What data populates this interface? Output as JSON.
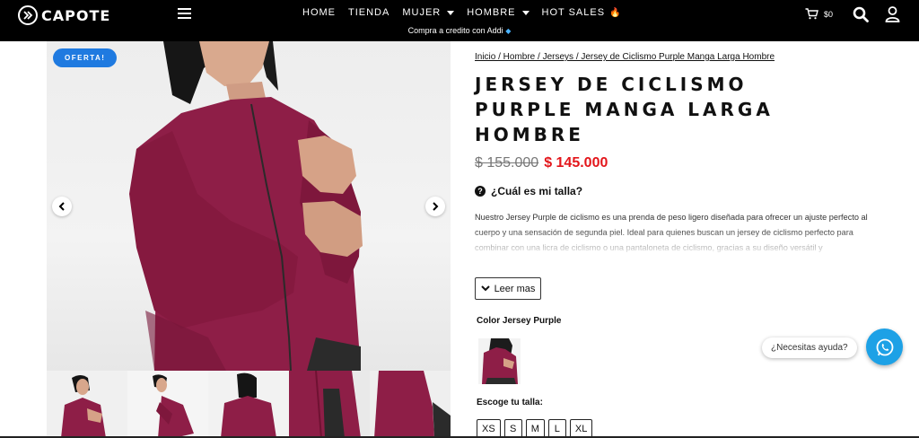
{
  "header": {
    "logo_text": "CAPOTE",
    "nav": [
      {
        "label": "HOME",
        "dropdown": false
      },
      {
        "label": "TIENDA",
        "dropdown": false
      },
      {
        "label": "MUJER",
        "dropdown": true
      },
      {
        "label": "HOMBRE",
        "dropdown": true
      },
      {
        "label": "HOT SALES",
        "dropdown": false,
        "emoji": "🔥"
      }
    ],
    "promo": "Compra a credito con Addi",
    "cart_total": "$0",
    "colors": {
      "bar": "#000000",
      "text": "#ffffff"
    }
  },
  "gallery": {
    "badge": "OFERTA!",
    "badge_color": "#1f7ae0",
    "prev_icon": "chevron-left-icon",
    "next_icon": "chevron-right-icon",
    "thumbnail_count": 5
  },
  "product": {
    "breadcrumb": "Inicio / Hombre / Jerseys / Jersey de Ciclismo Purple Manga Larga Hombre",
    "title": "JERSEY DE CICLISMO PURPLE MANGA LARGA HOMBRE",
    "price_old": "$ 155.000",
    "price_new": "$ 145.000",
    "price_color": "#e3161b",
    "size_help": "¿Cuál es mi talla?",
    "description": "Nuestro Jersey Purple de ciclismo es una prenda de peso ligero diseñada para ofrecer un ajuste perfecto al cuerpo y una sensación de segunda piel. Ideal para quienes buscan un jersey de ciclismo perfecto para combinar con una licra de ciclismo o una pantaloneta de ciclismo, gracias a su diseño versátil y",
    "read_more": "Leer mas",
    "color_label": "Color Jersey Purple",
    "size_label": "Escoge tu talla:",
    "sizes": [
      "XS",
      "S",
      "M",
      "L",
      "XL"
    ],
    "garment_color": "#8e1e47"
  },
  "chat": {
    "bubble": "¿Necesitas ayuda?",
    "button_color": "#1da1e6"
  }
}
